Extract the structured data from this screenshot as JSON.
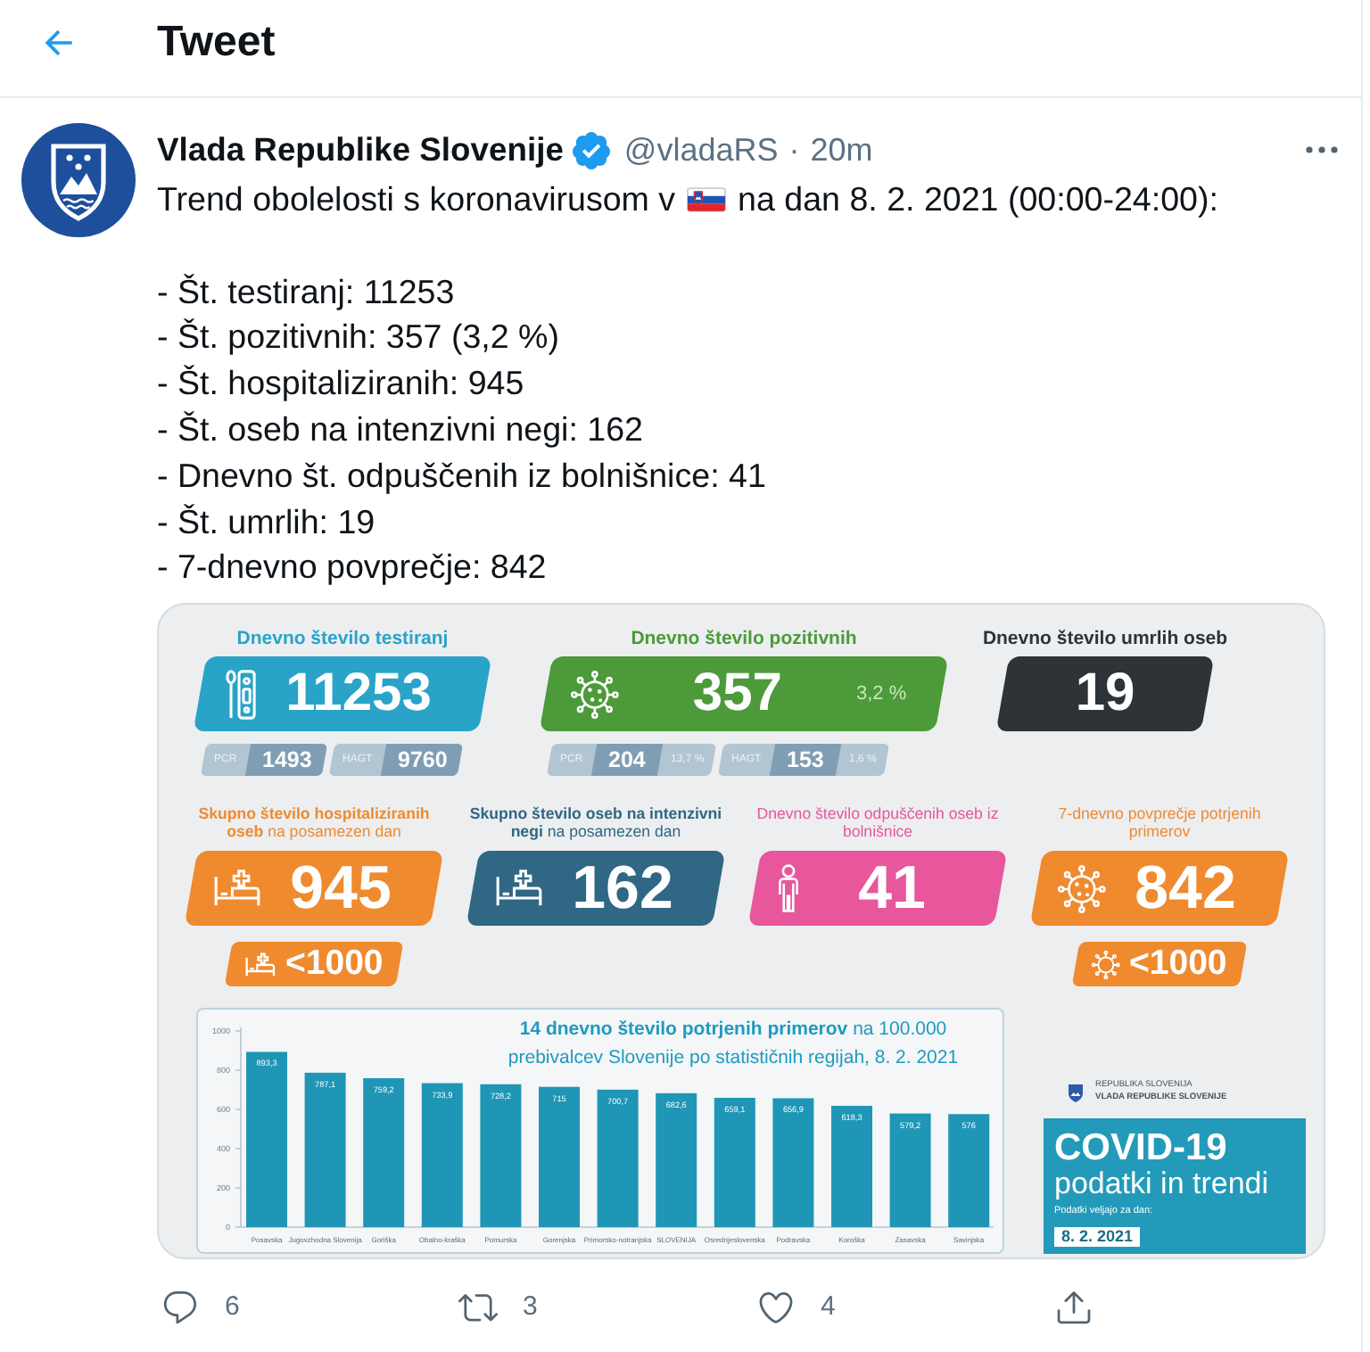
{
  "header": {
    "title": "Tweet"
  },
  "tweet": {
    "author": {
      "name": "Vlada Republike Slovenije",
      "verified": true,
      "handle": "@vladaRS",
      "separator": "·",
      "time": "20m"
    },
    "intro": [
      {
        "kind": "text",
        "text": "Trend obolelosti s koronavirusom v"
      },
      {
        "kind": "flag"
      },
      {
        "kind": "text",
        "text": "na dan 8. 2. 2021 (00:00-24:00):"
      }
    ],
    "lines": [
      "- Št. testiranj: 11253",
      "- Št. pozitivnih: 357 (3,2 %)",
      "- Št. hospitaliziranih: 945",
      "- Št. oseb na intenzivni negi: 162",
      "- Dnevno št. odpuščenih iz bolnišnice: 41",
      "- Št. umrlih: 19",
      "- 7-dnevno povprečje: 842"
    ],
    "infographic": {
      "daily": [
        {
          "kind": "tests",
          "color": "#29a3c8",
          "title": "Dnevno število testiranj",
          "value": "11253",
          "breakdown": [
            {
              "label": "PCR",
              "value": "1493"
            },
            {
              "label": "HAGT",
              "value": "9760"
            }
          ]
        },
        {
          "kind": "positive",
          "color": "#4c9a3a",
          "title": "Dnevno število pozitivnih",
          "value": "357",
          "share": "3,2 %",
          "breakdown": [
            {
              "label": "PCR",
              "value": "204",
              "share": "13,7 %"
            },
            {
              "label": "HAGT",
              "value": "153",
              "share": "1,6 %"
            }
          ]
        },
        {
          "kind": "deaths",
          "color": "#2d3336",
          "title": "Dnevno število umrlih oseb",
          "value": "19"
        }
      ],
      "totals": [
        {
          "kind": "hospitalized",
          "color": "#ef8a2e",
          "title": "**Skupno število hospitaliziranih oseb** na posamezen dan",
          "value": "945",
          "limit": "<1000"
        },
        {
          "kind": "icu",
          "color": "#2f6784",
          "title": "**Skupno število oseb na intenzivni negi** na posamezen dan",
          "value": "162"
        },
        {
          "kind": "discharged",
          "color": "#e8569c",
          "title": "Dnevno število odpuščenih oseb iz bolnišnice",
          "value": "41"
        },
        {
          "kind": "average",
          "color": "#ef8a2f",
          "title": "7-dnevno povprečje potrjenih primerov",
          "value": "842",
          "limit": "<1000"
        }
      ],
      "chart_data": {
        "type": "bar",
        "title": "**14 dnevno število potrjenih primerov** na 100.000 prebivalcev Slovenije po statističnih regijah, 8. 2. 2021",
        "categories": [
          "Posavska",
          "Jugovzhodna Slovenija",
          "Goriška",
          "Obalno-kraška",
          "Pomurska",
          "Gorenjska",
          "Primorsko-notranjska",
          "SLOVENIJA",
          "Osrednjeslovenska",
          "Podravska",
          "Koroška",
          "Zasavska",
          "Savinjska"
        ],
        "values": [
          893.3,
          787.1,
          759.2,
          733.9,
          728.2,
          715,
          700.7,
          682.6,
          659.1,
          656.9,
          618.3,
          579.2,
          576
        ],
        "ylim": [
          0,
          1000
        ],
        "yticks": [
          0,
          200,
          400,
          600,
          800,
          1000
        ],
        "value_labels": [
          "893,3",
          "787,1",
          "759,2",
          "733,9",
          "728,2",
          "715",
          "700,7",
          "682,6",
          "659,1",
          "656,9",
          "618,3",
          "579,2",
          "576"
        ]
      },
      "issuer": [
        "REPUBLIKA SLOVENIJA",
        "VLADA REPUBLIKE SLOVENIJE"
      ],
      "cover": {
        "title": "COVID-19",
        "subtitle": "podatki in trendi",
        "date_label": "Podatki veljajo za dan:",
        "date": "8. 2. 2021"
      }
    },
    "actions": [
      {
        "kind": "reply",
        "count": "6"
      },
      {
        "kind": "retweet",
        "count": "3"
      },
      {
        "kind": "like",
        "count": "4"
      },
      {
        "kind": "share"
      }
    ]
  }
}
